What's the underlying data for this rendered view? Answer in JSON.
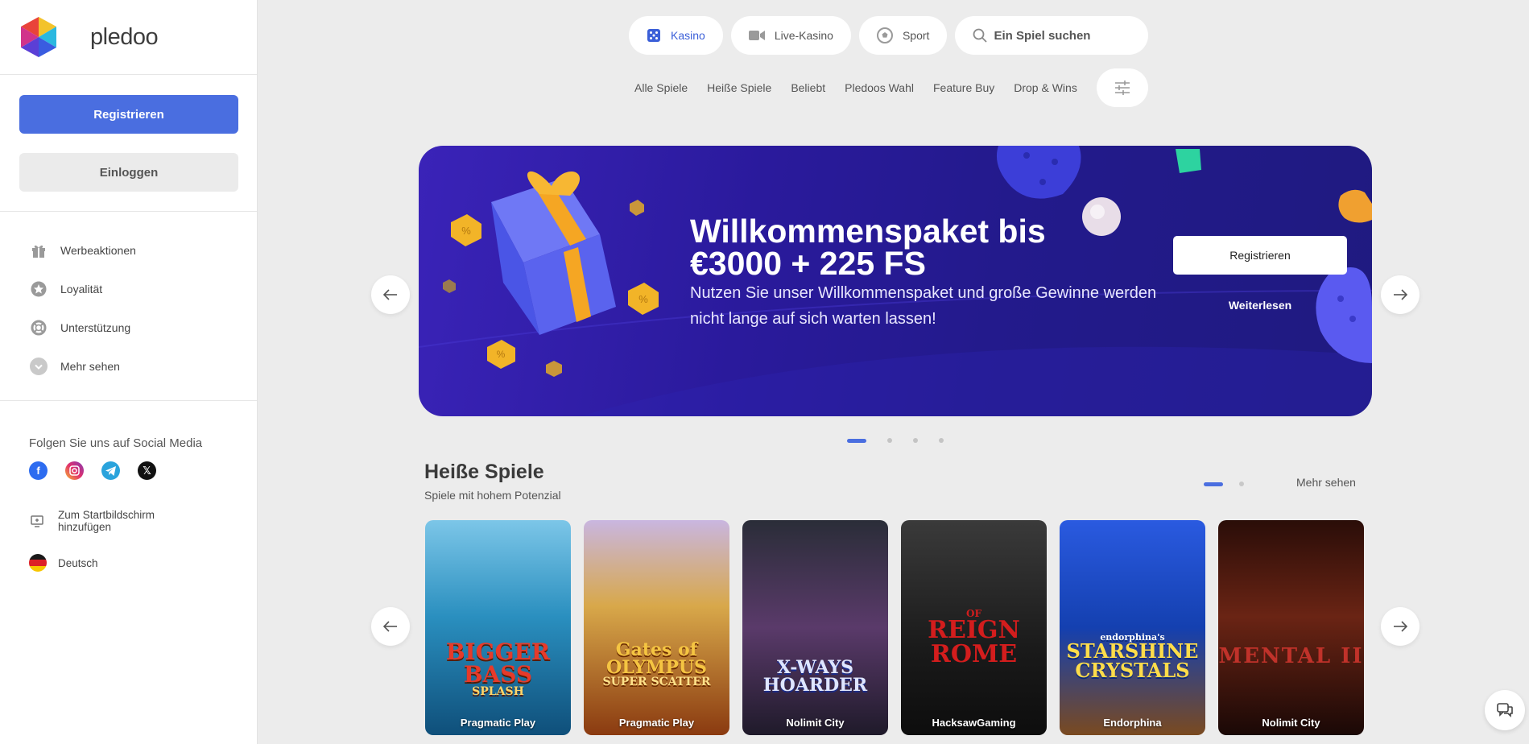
{
  "brand": {
    "name": "pledoo"
  },
  "auth": {
    "register_label": "Registrieren",
    "login_label": "Einloggen"
  },
  "menu": {
    "items": [
      {
        "label": "Werbeaktionen",
        "icon": "gift-icon"
      },
      {
        "label": "Loyalität",
        "icon": "star-icon"
      },
      {
        "label": "Unterstützung",
        "icon": "lifebuoy-icon"
      },
      {
        "label": "Mehr sehen",
        "icon": "chevron-down-icon"
      }
    ]
  },
  "social": {
    "title": "Folgen Sie uns auf Social Media",
    "networks": [
      "facebook-icon",
      "instagram-icon",
      "telegram-icon",
      "x-icon"
    ],
    "homescreen_label": "Zum Startbildschirm hinzufügen",
    "language_label": "Deutsch"
  },
  "topnav": {
    "tabs": [
      {
        "label": "Kasino",
        "icon": "dice-icon",
        "active": true
      },
      {
        "label": "Live-Kasino",
        "icon": "video-camera-icon",
        "active": false
      },
      {
        "label": "Sport",
        "icon": "soccer-ball-icon",
        "active": false
      }
    ],
    "search_placeholder": "Ein Spiel suchen"
  },
  "subnav": {
    "items": [
      "Alle Spiele",
      "Heiße Spiele",
      "Beliebt",
      "Pledoos Wahl",
      "Feature Buy",
      "Drop & Wins"
    ]
  },
  "banner": {
    "title_line1": "Willkommenspaket bis",
    "title_line2": "€3000 + 225 FS",
    "subtitle": "Nutzen Sie unser Willkommenspaket und große Gewinne werden nicht lange auf sich warten lassen!",
    "register_label": "Registrieren",
    "more_label": "Weiterlesen",
    "slide_count": 4,
    "active_slide": 1
  },
  "hot_games": {
    "title": "Heiße Spiele",
    "subtitle": "Spiele mit hohem Potenzial",
    "more_label": "Mehr sehen",
    "games": [
      {
        "art_title": "BIGGER BASS",
        "art_sub": "SPLASH",
        "provider": "Pragmatic Play",
        "bg": "#1f7fb0",
        "fg": "#e63a2a"
      },
      {
        "art_title": "Gates of OLYMPUS",
        "art_sub": "SUPER SCATTER",
        "provider": "Pragmatic Play",
        "bg": "#a86a1c",
        "fg": "#f5c542"
      },
      {
        "art_title": "X-WAYS HOARDER",
        "art_sub": "",
        "provider": "Nolimit City",
        "bg": "#3a2550",
        "fg": "#dfe6ff"
      },
      {
        "art_title": "REIGN ROME",
        "art_sub": "OF",
        "provider": "HacksawGaming",
        "bg": "#1d1d1d",
        "fg": "#d31d1d"
      },
      {
        "art_title": "STARSHINE CRYSTALS",
        "art_sub": "endorphina's",
        "provider": "Endorphina",
        "bg": "#1840b0",
        "fg": "#fddc4a"
      },
      {
        "art_title": "MENTAL II",
        "art_sub": "",
        "provider": "Nolimit City",
        "bg": "#3a140c",
        "fg": "#c0322a"
      }
    ]
  }
}
